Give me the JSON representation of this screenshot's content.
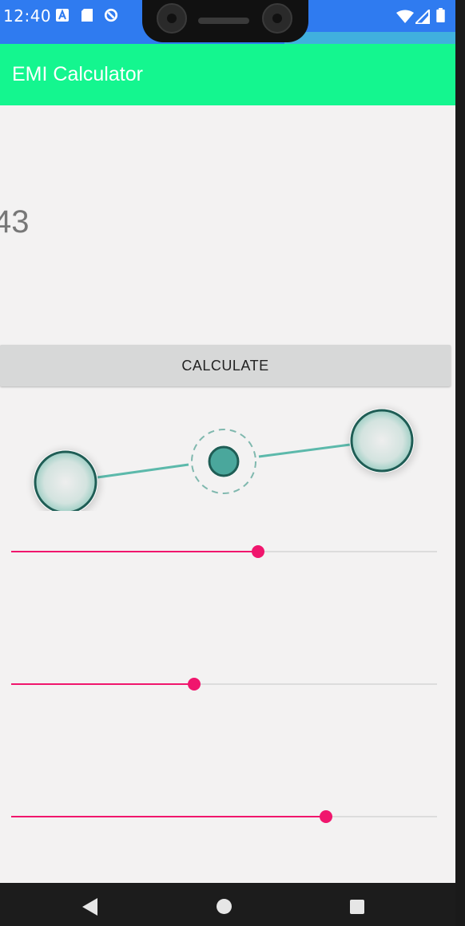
{
  "status_bar": {
    "time": "12:40",
    "left_icons": [
      "a-notification-icon",
      "sd-card-icon",
      "data-saver-icon"
    ],
    "right_icons": [
      "wifi-icon",
      "signal-icon",
      "battery-icon"
    ]
  },
  "app_bar": {
    "title": "EMI Calculator",
    "color": "#14f68f"
  },
  "result": {
    "value": "43"
  },
  "calculate_button": {
    "label": "CALCULATE"
  },
  "sliders": [
    {
      "name": "slider-1",
      "fraction": 0.58
    },
    {
      "name": "slider-2",
      "fraction": 0.43
    },
    {
      "name": "slider-3",
      "fraction": 0.74
    }
  ],
  "colors": {
    "accent": "#f0166d",
    "teal": "#4aa79c",
    "status_bar": "#2f7bf0"
  },
  "navigation": {
    "icons": [
      "back-icon",
      "home-icon",
      "recents-icon"
    ]
  }
}
